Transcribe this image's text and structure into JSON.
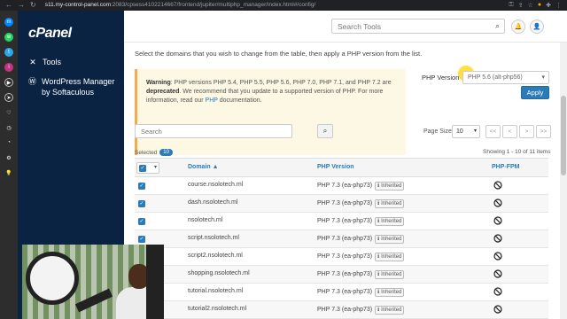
{
  "browser": {
    "back": "←",
    "forward": "→",
    "reload": "↻",
    "url_host": "s11.my-control-panel.com",
    "url_path": ":2083/cpsess4102214667/frontend/jupiter/multiphp_manager/index.html#/config/"
  },
  "sidebar": {
    "logo": "cPanel",
    "items": [
      {
        "label": "Tools",
        "icon": "tools-icon"
      },
      {
        "label": "WordPress Manager by Softaculous",
        "icon": "wordpress-icon"
      }
    ]
  },
  "header": {
    "search_placeholder": "Search Tools"
  },
  "main": {
    "intro": "Select the domains that you wish to change from the table, then apply a PHP version from the list.",
    "warning": {
      "label": "Warning",
      "text_before": ": PHP versions PHP 5.4, PHP 5.5, PHP 5.6, PHP 7.0, PHP 7.1, and PHP 7.2 are ",
      "bold": "deprecated",
      "text_after": ". We recommend that you update to a supported version of PHP. For more information, read our ",
      "link": "PHP",
      "text_end": " documentation."
    },
    "php_version_label": "PHP Version",
    "php_version_selected": "PHP 5.6 (alt-php56)",
    "apply_label": "Apply",
    "search_placeholder": "Search",
    "page_size_label": "Page Size",
    "page_size_value": "10",
    "pager": [
      "<<",
      "<",
      ">",
      ">>"
    ],
    "selected_label": "Selected",
    "selected_count": "10",
    "showing": "Showing 1 - 10 of 11 items",
    "columns": {
      "domain": "Domain ▲",
      "php_version": "PHP Version",
      "php_fpm": "PHP-FPM"
    },
    "inherited_label": "Inherited",
    "rows": [
      {
        "domain": "course.nsolotech.ml",
        "php": "PHP 7.3 (ea-php73)"
      },
      {
        "domain": "dash.nsolotech.ml",
        "php": "PHP 7.3 (ea-php73)"
      },
      {
        "domain": "nsolotech.ml",
        "php": "PHP 7.3 (ea-php73)"
      },
      {
        "domain": "script.nsolotech.ml",
        "php": "PHP 7.3 (ea-php73)"
      },
      {
        "domain": "script2.nsolotech.ml",
        "php": "PHP 7.3 (ea-php73)"
      },
      {
        "domain": "shopping.nsolotech.ml",
        "php": "PHP 7.3 (ea-php73)"
      },
      {
        "domain": "tutorial.nsolotech.ml",
        "php": "PHP 7.3 (ea-php73)"
      },
      {
        "domain": "tutorial2.nsolotech.ml",
        "php": "PHP 7.3 (ea-php73)"
      }
    ]
  },
  "colors": {
    "sidebar_bg": "#0a2343",
    "accent": "#2b7bb9",
    "warning_bg": "#fcf8e3"
  }
}
